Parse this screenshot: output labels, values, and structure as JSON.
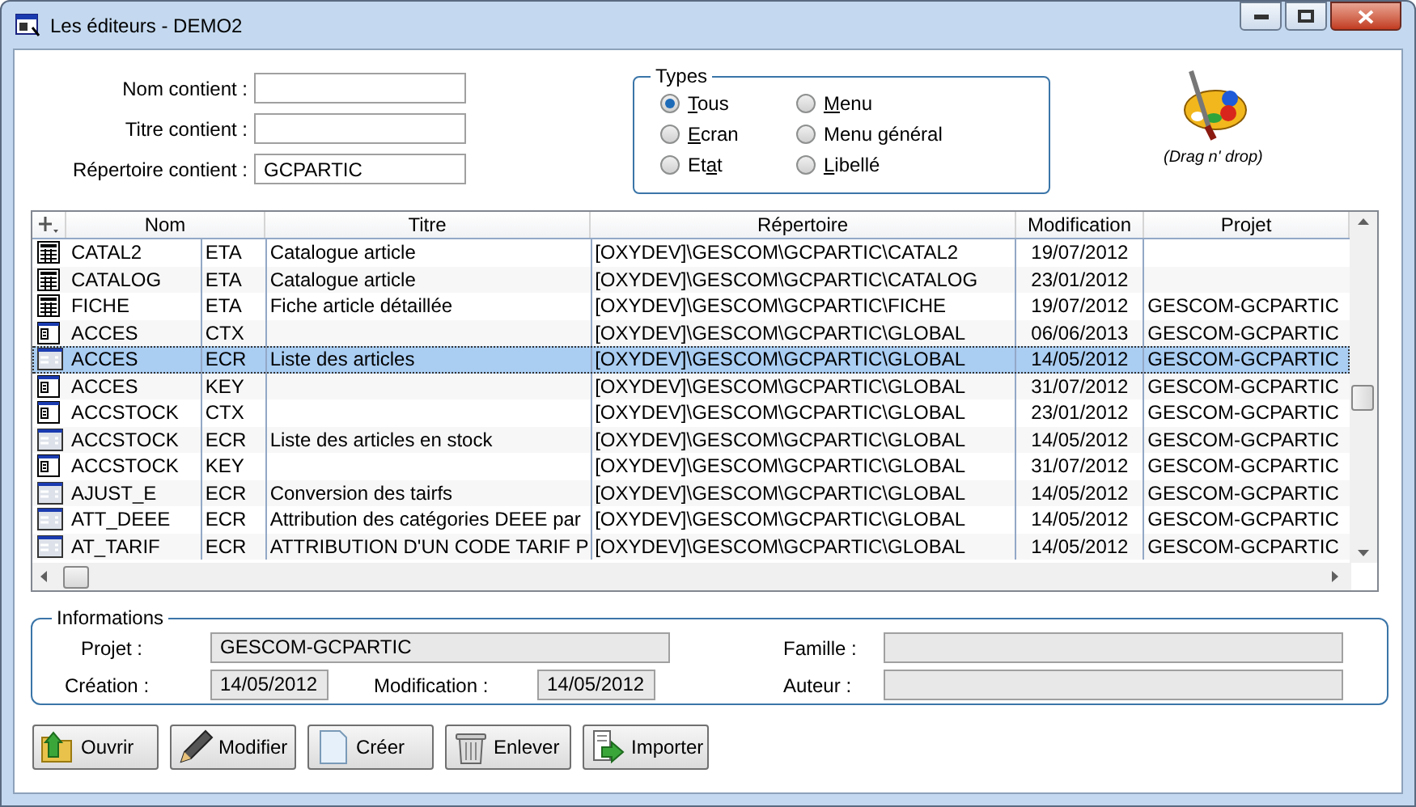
{
  "window": {
    "title": "Les éditeurs - DEMO2"
  },
  "filters": [
    {
      "label": "Nom contient :"
    },
    {
      "label": "Titre contient :"
    },
    {
      "label": "Répertoire contient :",
      "value": "GCPARTIC"
    }
  ],
  "types": {
    "title": "Types",
    "options": [
      {
        "key": "T",
        "post": "ous",
        "selected": true
      },
      {
        "key": "E",
        "post": "cran",
        "selected": false
      },
      {
        "pre": "Et",
        "key": "a",
        "post": "t",
        "selected": false
      },
      {
        "key": "M",
        "post": "enu",
        "selected": false
      },
      {
        "pre": "Menu ",
        "key": "g",
        "post": "énéral",
        "selected": false
      },
      {
        "key": "L",
        "post": "ibellé",
        "selected": false
      }
    ]
  },
  "drag_hint": "(Drag n' drop)",
  "table": {
    "columns": [
      "Nom",
      "Titre",
      "Répertoire",
      "Modification",
      "Projet"
    ],
    "rows": [
      {
        "kind": "report",
        "nom": "CATAL2",
        "type": "ETA",
        "titre": "Catalogue article",
        "repertoire": "[OXYDEV]\\GESCOM\\GCPARTIC\\CATAL2",
        "modification": "19/07/2012",
        "selected": false
      },
      {
        "kind": "report",
        "nom": "CATALOG",
        "type": "ETA",
        "titre": "Catalogue article",
        "repertoire": "[OXYDEV]\\GESCOM\\GCPARTIC\\CATALOG",
        "modification": "23/01/2012",
        "selected": false
      },
      {
        "kind": "report",
        "nom": "FICHE",
        "type": "ETA",
        "titre": "Fiche article détaillée",
        "repertoire": "[OXYDEV]\\GESCOM\\GCPARTIC\\FICHE",
        "modification": "19/07/2012",
        "projet": "GESCOM-GCPARTIC",
        "selected": false
      },
      {
        "kind": "context",
        "nom": "ACCES",
        "type": "CTX",
        "repertoire": "[OXYDEV]\\GESCOM\\GCPARTIC\\GLOBAL",
        "modification": "06/06/2013",
        "projet": "GESCOM-GCPARTIC",
        "selected": false
      },
      {
        "kind": "screen",
        "nom": "ACCES",
        "type": "ECR",
        "titre": "Liste des articles",
        "repertoire": "[OXYDEV]\\GESCOM\\GCPARTIC\\GLOBAL",
        "modification": "14/05/2012",
        "projet": "GESCOM-GCPARTIC",
        "selected": true
      },
      {
        "kind": "context",
        "nom": "ACCES",
        "type": "KEY",
        "repertoire": "[OXYDEV]\\GESCOM\\GCPARTIC\\GLOBAL",
        "modification": "31/07/2012",
        "projet": "GESCOM-GCPARTIC",
        "selected": false
      },
      {
        "kind": "context",
        "nom": "ACCSTOCK",
        "type": "CTX",
        "repertoire": "[OXYDEV]\\GESCOM\\GCPARTIC\\GLOBAL",
        "modification": "23/01/2012",
        "projet": "GESCOM-GCPARTIC",
        "selected": false
      },
      {
        "kind": "screen",
        "nom": "ACCSTOCK",
        "type": "ECR",
        "titre": "Liste des articles en stock",
        "repertoire": "[OXYDEV]\\GESCOM\\GCPARTIC\\GLOBAL",
        "modification": "14/05/2012",
        "projet": "GESCOM-GCPARTIC",
        "selected": false
      },
      {
        "kind": "context",
        "nom": "ACCSTOCK",
        "type": "KEY",
        "repertoire": "[OXYDEV]\\GESCOM\\GCPARTIC\\GLOBAL",
        "modification": "31/07/2012",
        "projet": "GESCOM-GCPARTIC",
        "selected": false
      },
      {
        "kind": "screen",
        "nom": "AJUST_E",
        "type": "ECR",
        "titre": "Conversion des tairfs",
        "repertoire": "[OXYDEV]\\GESCOM\\GCPARTIC\\GLOBAL",
        "modification": "14/05/2012",
        "projet": "GESCOM-GCPARTIC",
        "selected": false
      },
      {
        "kind": "screen",
        "nom": "ATT_DEEE",
        "type": "ECR",
        "titre": "Attribution des catégories DEEE par",
        "repertoire": "[OXYDEV]\\GESCOM\\GCPARTIC\\GLOBAL",
        "modification": "14/05/2012",
        "projet": "GESCOM-GCPARTIC",
        "selected": false
      },
      {
        "kind": "screen",
        "nom": "AT_TARIF",
        "type": "ECR",
        "titre": "ATTRIBUTION D'UN CODE TARIF P",
        "repertoire": "[OXYDEV]\\GESCOM\\GCPARTIC\\GLOBAL",
        "modification": "14/05/2012",
        "projet": "GESCOM-GCPARTIC",
        "selected": false
      }
    ]
  },
  "informations": {
    "title": "Informations",
    "projet": {
      "label": "Projet :",
      "value": "GESCOM-GCPARTIC"
    },
    "creation": {
      "label": "Création :",
      "value": "14/05/2012"
    },
    "modification": {
      "label": "Modification :",
      "value": "14/05/2012"
    },
    "famille": {
      "label": "Famille :"
    },
    "auteur": {
      "label": "Auteur :"
    }
  },
  "buttons": [
    {
      "kind": "open",
      "label": "Ouvrir"
    },
    {
      "kind": "edit",
      "label": "Modifier"
    },
    {
      "kind": "new",
      "label": "Créer"
    },
    {
      "kind": "delete",
      "label": "Enlever"
    },
    {
      "kind": "import",
      "label": "Importer"
    }
  ]
}
